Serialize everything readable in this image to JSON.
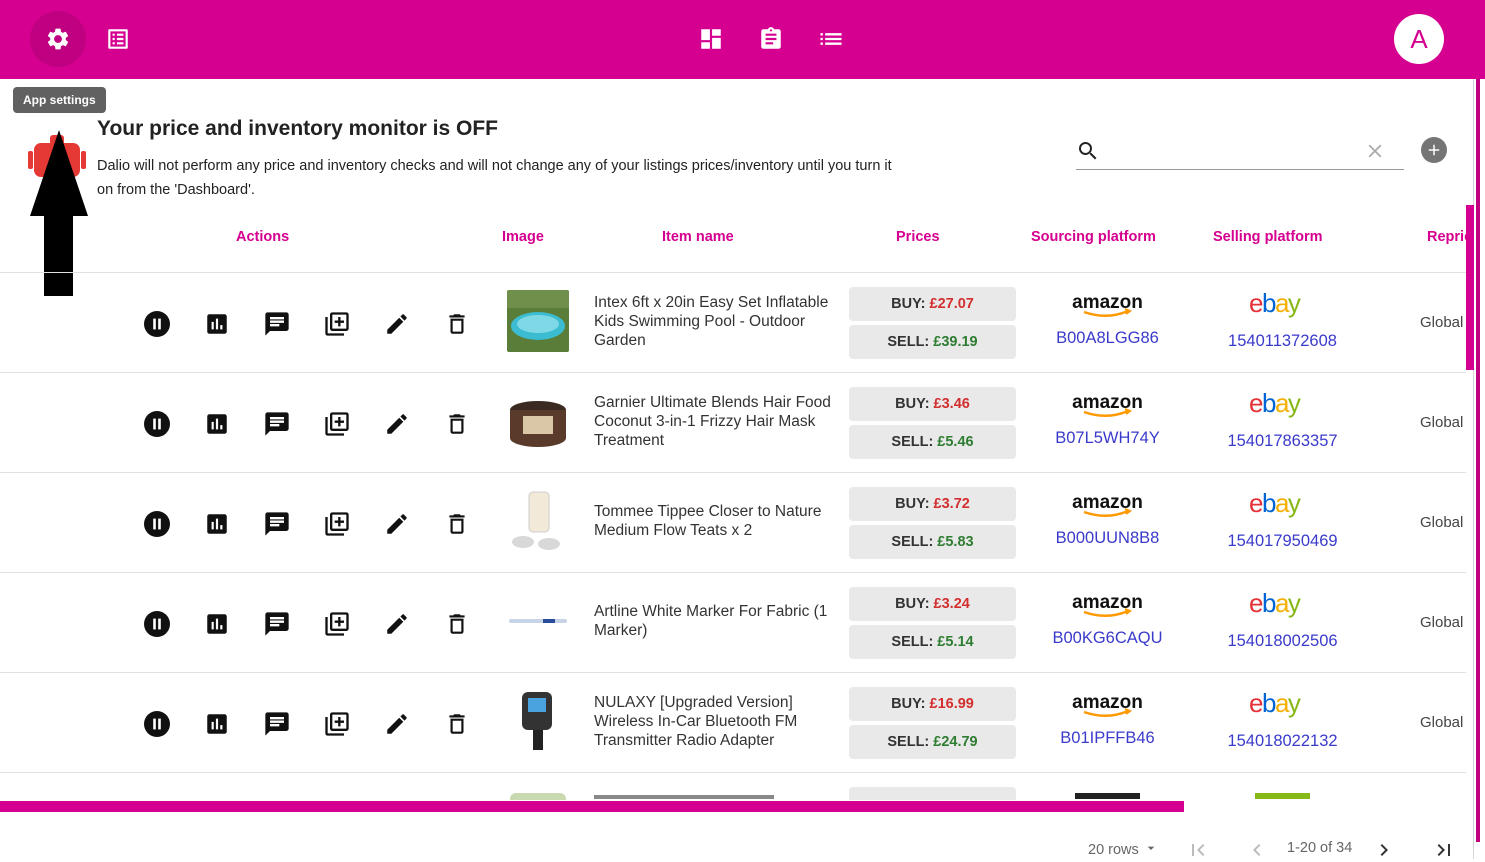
{
  "colors": {
    "brand": "#d5008f",
    "buy": "#d32f2f",
    "sell": "#2e7d32",
    "link": "#3a3acb",
    "monitor_icon": "#e53935"
  },
  "header": {
    "left_icons": [
      "gear-icon",
      "listings-icon"
    ],
    "center_icons": [
      "dashboard-icon",
      "clipboard-icon",
      "list-icon"
    ],
    "avatar_initial": "A"
  },
  "tooltip": "App settings",
  "notice": {
    "title": "Your price and inventory monitor is OFF",
    "text": "Dalio will not perform any price and inventory checks and will not change any of your listings prices/inventory until you turn it on from the 'Dashboard'."
  },
  "search": {
    "value": "",
    "placeholder": ""
  },
  "table": {
    "headers": {
      "actions": "Actions",
      "image": "Image",
      "item_name": "Item name",
      "prices": "Prices",
      "sourcing": "Sourcing platform",
      "selling": "Selling platform",
      "reprice": "Repric"
    },
    "buy_label": "BUY:",
    "sell_label": "SELL:",
    "rows": [
      {
        "name": "Intex 6ft x 20in Easy Set Inflatable Kids Swimming Pool - Outdoor Garden",
        "buy": "£27.07",
        "sell": "£39.19",
        "source_logo": "amazon",
        "asin": "B00A8LGG86",
        "selling_logo": "ebay",
        "ebay_id": "154011372608",
        "reprice": "Global"
      },
      {
        "name": "Garnier Ultimate Blends Hair Food Coconut 3-in-1 Frizzy Hair Mask Treatment",
        "buy": "£3.46",
        "sell": "£5.46",
        "source_logo": "amazon",
        "asin": "B07L5WH74Y",
        "selling_logo": "ebay",
        "ebay_id": "154017863357",
        "reprice": "Global"
      },
      {
        "name": "Tommee Tippee Closer to Nature Medium Flow Teats x 2",
        "buy": "£3.72",
        "sell": "£5.83",
        "source_logo": "amazon",
        "asin": "B000UUN8B8",
        "selling_logo": "ebay",
        "ebay_id": "154017950469",
        "reprice": "Global"
      },
      {
        "name": "Artline White Marker For Fabric (1 Marker)",
        "buy": "£3.24",
        "sell": "£5.14",
        "source_logo": "amazon",
        "asin": "B00KG6CAQU",
        "selling_logo": "ebay",
        "ebay_id": "154018002506",
        "reprice": "Global"
      },
      {
        "name": "NULAXY [Upgraded Version] Wireless In-Car Bluetooth FM Transmitter Radio Adapter",
        "buy": "£16.99",
        "sell": "£24.79",
        "source_logo": "amazon",
        "asin": "B01IPFFB46",
        "selling_logo": "ebay",
        "ebay_id": "154018022132",
        "reprice": "Global"
      }
    ],
    "row_actions": [
      "pause-icon",
      "stats-icon",
      "notes-icon",
      "duplicate-icon",
      "edit-icon",
      "delete-icon"
    ]
  },
  "pagination": {
    "rows_per_page": "20 rows",
    "range": "1-20 of 34"
  }
}
